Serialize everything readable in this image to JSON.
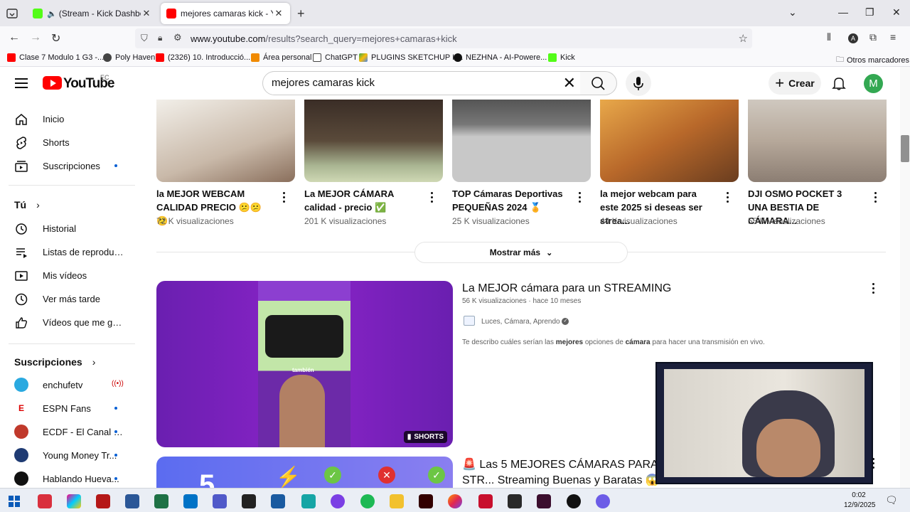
{
  "browser": {
    "tabs": [
      {
        "title": "(Stream - Kick Dashboard",
        "active": false
      },
      {
        "title": "mejores camaras kick - YouTube",
        "active": true
      }
    ],
    "url_host": "www.youtube.com",
    "url_path": "/results?search_query=mejores+camaras+kick",
    "bookmarks": [
      "Clase 7 Modulo 1 G3 -...",
      "Poly Haven",
      "(2326) 10. Introducció...",
      "Área personal",
      "ChatGPT",
      "PLUGINS SKETCHUP I ...",
      "NEZHNA - AI-Powere...",
      "Kick"
    ],
    "other_bookmarks": "Otros marcadores"
  },
  "youtube": {
    "logo_text": "YouTube",
    "country_code": "EC",
    "search_query": "mejores camaras kick",
    "create_label": "Crear",
    "avatar_letter": "M"
  },
  "sidebar": {
    "main": [
      "Inicio",
      "Shorts",
      "Suscripciones"
    ],
    "you_heading": "Tú",
    "you_items": [
      "Historial",
      "Listas de reproducc...",
      "Mis vídeos",
      "Ver más tarde",
      "Vídeos que me gus..."
    ],
    "subs_heading": "Suscripciones",
    "subs": [
      "enchufetv",
      "ESPN Fans",
      "ECDF - El Canal d...",
      "Young Money Tr...",
      "Hablando Hueva..."
    ]
  },
  "cards": [
    {
      "title": "la MEJOR WEBCAM CALIDAD PRECIO 😕😕😕",
      "views": "72 K visualizaciones"
    },
    {
      "title": "La MEJOR CÁMARA calidad - precio ✅",
      "views": "201 K visualizaciones"
    },
    {
      "title": "TOP Cámaras Deportivas PEQUEÑAS 2024 🏅",
      "views": "25 K visualizaciones"
    },
    {
      "title": "la mejor webcam para este 2025 si deseas ser strea...",
      "views": "44 K visualizaciones"
    },
    {
      "title": "DJI OSMO POCKET 3 UNA BESTIA DE CÁMARA...",
      "views": "55 K visualizaciones"
    }
  ],
  "show_more": "Mostrar más",
  "video1": {
    "title": "La MEJOR cámara para un STREAMING",
    "views": "56 K visualizaciones",
    "age": "hace 10 meses",
    "channel": "Luces, Cámara, Aprendo",
    "desc_pre": "Te describo cuáles serían las ",
    "desc_b1": "mejores",
    "desc_mid": " opciones de ",
    "desc_b2": "cámara",
    "desc_post": " para hacer una transmisión en vivo.",
    "badge": "SHORTS",
    "thumb_caption": "también"
  },
  "video2": {
    "title": "🚨 Las 5 MEJORES CÁMARAS PARA STR... Streaming Buenas y Baratas 😱"
  },
  "taskbar": {
    "time": "0:02",
    "date": "12/9/2025"
  }
}
